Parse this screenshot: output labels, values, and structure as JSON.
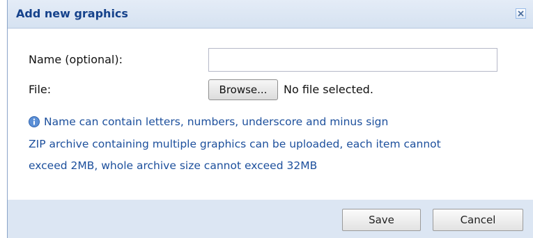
{
  "dialog": {
    "title": "Add new graphics",
    "close_icon": "close-icon"
  },
  "form": {
    "name_label": "Name (optional):",
    "name_value": "",
    "file_label": "File:",
    "browse_label": "Browse...",
    "file_status": "No file selected."
  },
  "info": {
    "icon": "info-icon",
    "lines": [
      "Name can contain letters, numbers, underscore and minus sign",
      "ZIP archive containing multiple graphics can be uploaded, each item cannot",
      "exceed 2MB, whole archive size cannot exceed 32MB"
    ]
  },
  "footer": {
    "save_label": "Save",
    "cancel_label": "Cancel"
  },
  "colors": {
    "title_text": "#15428b",
    "info_text": "#1c4f9c",
    "footer_bg": "#dce6f3"
  }
}
